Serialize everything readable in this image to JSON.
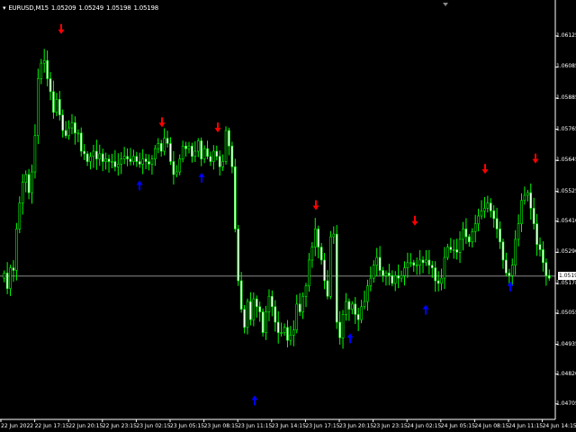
{
  "window": {
    "symbol": "EURUSD,M15",
    "open": "1.05209",
    "high": "1.05249",
    "low": "1.05198",
    "close": "1.05198"
  },
  "price_tag": "1.05198",
  "price_line_value": 1.05198,
  "colors": {
    "background": "#000000",
    "bull_candle": "#00ff00",
    "bear_candle": "#ffffff",
    "text": "#ffffff",
    "sell_arrow": "#ff0000",
    "buy_arrow": "#0000ff",
    "price_line": "#8c8c8c"
  },
  "chart_data": {
    "type": "candlestick",
    "yticks": [
      "1.06125",
      "1.06085",
      "1.05885",
      "1.05765",
      "1.05645",
      "1.05525",
      "1.05410",
      "1.05290",
      "1.05178",
      "1.05055",
      "1.04935",
      "1.04820",
      "1.04705"
    ],
    "ytick_values": [
      1.06125,
      1.06005,
      1.05885,
      1.05765,
      1.05645,
      1.05525,
      1.0541,
      1.0529,
      1.0517,
      1.05055,
      1.04935,
      1.0482,
      1.04705
    ],
    "ylim": [
      1.04645,
      1.06215
    ],
    "xticks": [
      "22 Jun 2022",
      "22 Jun 17:15",
      "22 Jun 20:15",
      "22 Jun 23:15",
      "23 Jun 02:15",
      "23 Jun 05:15",
      "23 Jun 08:15",
      "23 Jun 11:15",
      "23 Jun 14:15",
      "23 Jun 17:15",
      "23 Jun 20:15",
      "23 Jun 23:15",
      "24 Jun 02:15",
      "24 Jun 05:15",
      "24 Jun 08:15",
      "24 Jun 11:15",
      "24 Jun 14:15"
    ],
    "close_series": [
      1.0521,
      1.0515,
      1.0523,
      1.0522,
      1.0538,
      1.0548,
      1.0556,
      1.0559,
      1.0552,
      1.056,
      1.0574,
      1.0596,
      1.0602,
      1.0603,
      1.0596,
      1.0591,
      1.0583,
      1.0588,
      1.0582,
      1.0576,
      1.0574,
      1.0577,
      1.0579,
      1.0575,
      1.0575,
      1.0568,
      1.0567,
      1.0564,
      1.0566,
      1.0568,
      1.0565,
      1.0567,
      1.0564,
      1.0565,
      1.0564,
      1.0564,
      1.0562,
      1.0563,
      1.0565,
      1.0566,
      1.0565,
      1.0564,
      1.0566,
      1.0564,
      1.0563,
      1.0565,
      1.0564,
      1.0563,
      1.0565,
      1.0569,
      1.0571,
      1.0568,
      1.0573,
      1.0571,
      1.0564,
      1.0559,
      1.056,
      1.0565,
      1.057,
      1.0569,
      1.057,
      1.0566,
      1.0568,
      1.0572,
      1.0565,
      1.0569,
      1.0566,
      1.0564,
      1.0568,
      1.0566,
      1.0562,
      1.0564,
      1.0576,
      1.057,
      1.0562,
      1.0538,
      1.0518,
      1.0507,
      1.05,
      1.051,
      1.0503,
      1.0511,
      1.0508,
      1.0506,
      1.0498,
      1.0506,
      1.0512,
      1.0508,
      1.0502,
      1.0498,
      1.0498,
      1.05,
      1.0495,
      1.0497,
      1.0499,
      1.0509,
      1.0506,
      1.0512,
      1.0516,
      1.0526,
      1.0531,
      1.0538,
      1.0531,
      1.0526,
      1.0518,
      1.0512,
      1.0535,
      1.0536,
      1.0502,
      1.0496,
      1.0505,
      1.051,
      1.0507,
      1.0509,
      1.0505,
      1.0503,
      1.0508,
      1.051,
      1.0516,
      1.0519,
      1.0524,
      1.0527,
      1.0522,
      1.052,
      1.0521,
      1.052,
      1.0517,
      1.052,
      1.0519,
      1.052,
      1.0523,
      1.0525,
      1.0525,
      1.0524,
      1.0524,
      1.0526,
      1.0525,
      1.0526,
      1.0524,
      1.0523,
      1.0518,
      1.0517,
      1.0519,
      1.0527,
      1.0531,
      1.053,
      1.053,
      1.0529,
      1.0534,
      1.0538,
      1.0535,
      1.0533,
      1.0537,
      1.054,
      1.0543,
      1.0545,
      1.0546,
      1.0548,
      1.0545,
      1.0542,
      1.0538,
      1.0533,
      1.0526,
      1.0521,
      1.052,
      1.0524,
      1.0534,
      1.054,
      1.0549,
      1.0551,
      1.0552,
      1.0546,
      1.054,
      1.0532,
      1.053,
      1.0525,
      1.052,
      1.0519
    ],
    "sell_signals": [
      {
        "time": "22 Jun 17:15 area",
        "price": 1.0615
      },
      {
        "time": "23 Jun 03:30 area",
        "price": 1.0579
      },
      {
        "time": "23 Jun 08:15 area",
        "price": 1.0577
      },
      {
        "time": "23 Jun 17:15 area",
        "price": 1.0547
      },
      {
        "time": "24 Jun 01:00 area",
        "price": 1.0541
      },
      {
        "time": "24 Jun 07:15 area",
        "price": 1.0561
      },
      {
        "time": "24 Jun 13:00 area",
        "price": 1.0565
      }
    ],
    "buy_signals": [
      {
        "time": "23 Jun 02:15 area",
        "price": 1.0555
      },
      {
        "time": "23 Jun 06:30 area",
        "price": 1.0558
      },
      {
        "time": "23 Jun 13:00 area",
        "price": 1.0472
      },
      {
        "time": "23 Jun 18:45 area",
        "price": 1.0496
      },
      {
        "time": "24 Jun 03:00 area",
        "price": 1.0507
      },
      {
        "time": "24 Jun 11:15 area",
        "price": 1.0516
      }
    ]
  }
}
